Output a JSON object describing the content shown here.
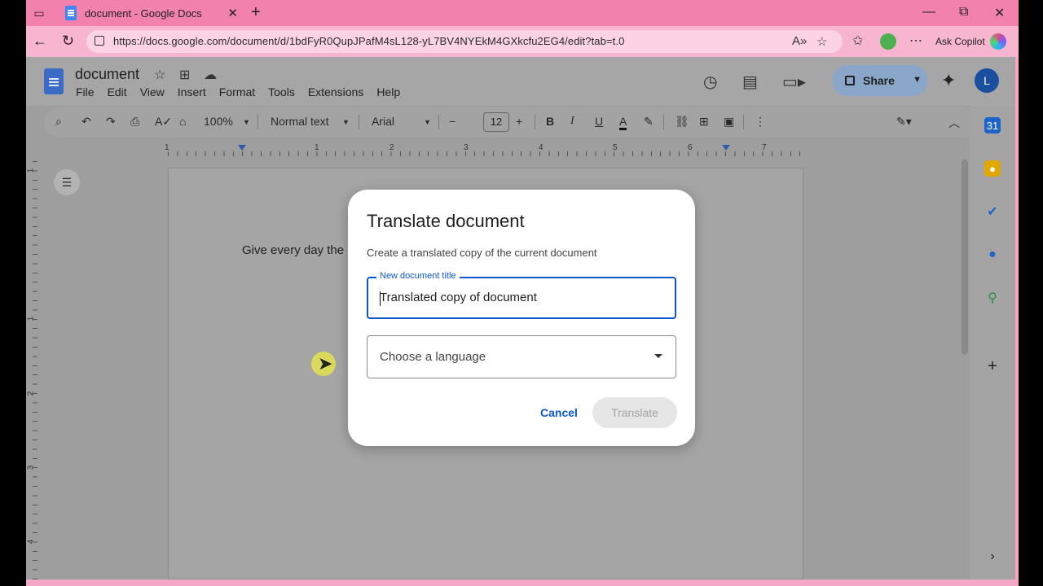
{
  "browser": {
    "tab_title": "document - Google Docs",
    "url": "https://docs.google.com/document/d/1bdFyR0QupJPafM4sL128-yL7BV4NYEkM4GXkcfu2EG4/edit?tab=t.0",
    "copilot_label": "Ask Copilot"
  },
  "docs": {
    "doc_name": "document",
    "menu": [
      "File",
      "Edit",
      "View",
      "Insert",
      "Format",
      "Tools",
      "Extensions",
      "Help"
    ],
    "share_label": "Share",
    "avatar_letter": "L",
    "toolbar": {
      "zoom": "100%",
      "style": "Normal text",
      "font": "Arial",
      "font_size": "12"
    },
    "ruler_numbers": [
      "1",
      "1",
      "2",
      "3",
      "4",
      "5",
      "6",
      "7"
    ],
    "vruler_numbers": [
      "1",
      "1",
      "2",
      "3",
      "4"
    ],
    "page_text": "Give every day the"
  },
  "dialog": {
    "title": "Translate document",
    "subtitle": "Create a translated copy of the current document",
    "field_label": "New document title",
    "field_value": "Translated copy of document",
    "select_placeholder": "Choose a language",
    "cancel_label": "Cancel",
    "translate_label": "Translate"
  },
  "colors": {
    "browser_frame": "#f282ad",
    "accent_blue": "#0b57d0",
    "share_bg": "#8aa7c9"
  },
  "icons": [
    "sidebar-toggle-icon",
    "docs-icon",
    "close-icon",
    "plus-icon",
    "back-icon",
    "reload-icon",
    "lock-icon",
    "read-aloud-icon",
    "star-icon",
    "favorites-icon",
    "extension-icon",
    "more-icon",
    "history-icon",
    "comment-icon",
    "video-icon",
    "gemini-icon",
    "search-icon",
    "undo-icon",
    "redo-icon",
    "print-icon",
    "spellcheck-icon",
    "paint-format-icon",
    "bold-icon",
    "italic-icon",
    "underline-icon",
    "text-color-icon",
    "highlight-icon",
    "link-icon",
    "add-comment-icon",
    "image-icon",
    "pencil-icon",
    "chevron-up-icon",
    "outline-icon",
    "calendar-icon",
    "keep-icon",
    "tasks-icon",
    "contacts-icon",
    "maps-icon",
    "chevron-right-icon"
  ]
}
